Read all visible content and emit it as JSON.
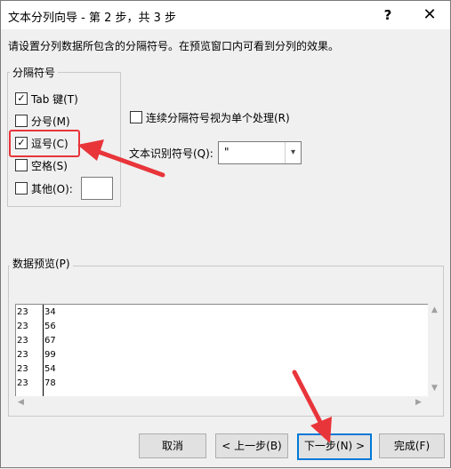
{
  "dialog": {
    "title": "文本分列向导 - 第 2 步，共 3 步",
    "help_label": "?",
    "close_label": "✕",
    "instruction": "请设置分列数据所包含的分隔符号。在预览窗口内可看到分列的效果。"
  },
  "delimiters": {
    "group_label": "分隔符号",
    "options": [
      {
        "label": "Tab 键(T)",
        "checked": true
      },
      {
        "label": "分号(M)",
        "checked": false
      },
      {
        "label": "逗号(C)",
        "checked": true
      },
      {
        "label": "空格(S)",
        "checked": false
      },
      {
        "label": "其他(O):",
        "checked": false
      }
    ],
    "other_value": ""
  },
  "consecutive": {
    "label": "连续分隔符号视为单个处理(R)",
    "checked": false
  },
  "text_qualifier": {
    "label": "文本识别符号(Q):",
    "value": "\"",
    "arrow": "▾"
  },
  "preview": {
    "label": "数据预览(P)",
    "rows": [
      [
        "23",
        "34"
      ],
      [
        "23",
        "56"
      ],
      [
        "23",
        "67"
      ],
      [
        "23",
        "99"
      ],
      [
        "23",
        "54"
      ],
      [
        "23",
        "78"
      ]
    ]
  },
  "buttons": {
    "cancel": "取消",
    "back": "< 上一步(B)",
    "next": "下一步(N) >",
    "finish": "完成(F)"
  },
  "colors": {
    "annotation_red": "#e8353a",
    "default_button_border": "#0078d7"
  }
}
